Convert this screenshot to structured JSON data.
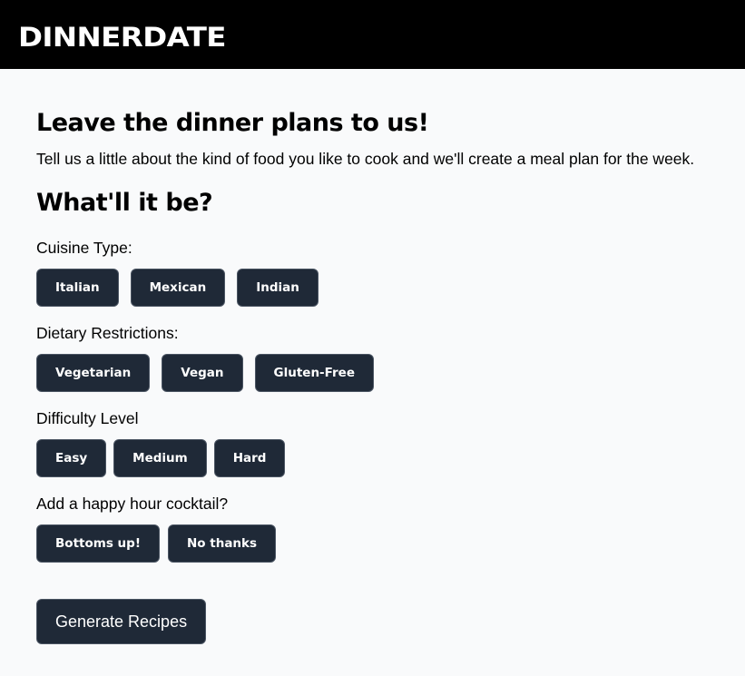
{
  "header": {
    "logo_text": "DINNERDATE"
  },
  "main": {
    "headline": "Leave the dinner plans to us!",
    "intro": "Tell us a little about the kind of food you like to cook and we'll create a meal plan for the week.",
    "subhead": "What'll it be?",
    "groups": [
      {
        "label": "Cuisine Type:",
        "options": [
          "Italian",
          "Mexican",
          "Indian"
        ]
      },
      {
        "label": "Dietary Restrictions:",
        "options": [
          "Vegetarian",
          "Vegan",
          "Gluten-Free"
        ]
      },
      {
        "label": "Difficulty Level",
        "options": [
          "Easy",
          "Medium",
          "Hard"
        ]
      },
      {
        "label": "Add a happy hour cocktail?",
        "options": [
          "Bottoms up!",
          "No thanks"
        ]
      }
    ],
    "generate_label": "Generate Recipes"
  },
  "colors": {
    "header_bg": "#000000",
    "page_bg": "#f9fafb",
    "button_bg": "#1f2937",
    "button_text": "#ffffff"
  }
}
